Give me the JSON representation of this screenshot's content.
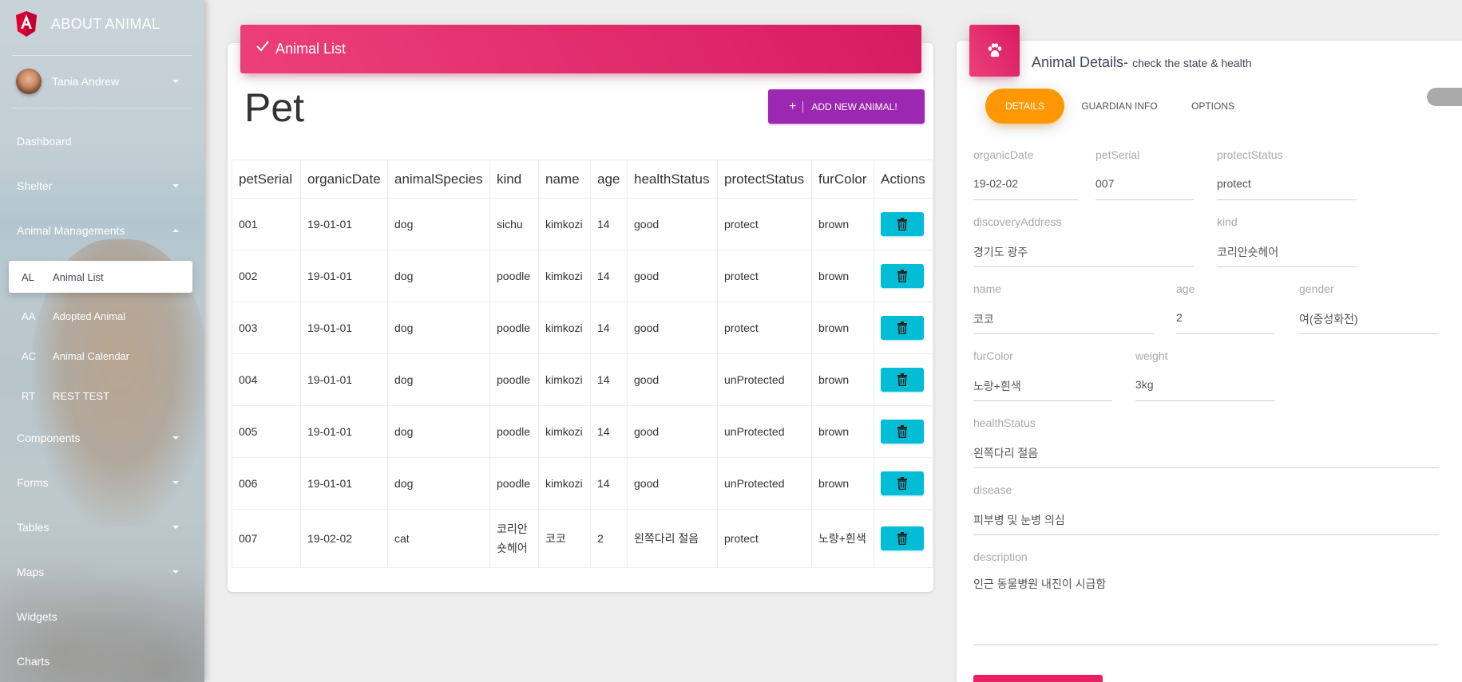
{
  "sidebar": {
    "brand": "ABOUT ANIMAL",
    "user": "Tania Andrew",
    "nav": [
      {
        "label": "Dashboard"
      },
      {
        "label": "Shelter"
      },
      {
        "label": "Animal Managements"
      },
      {
        "label": "Components"
      },
      {
        "label": "Forms"
      },
      {
        "label": "Tables"
      },
      {
        "label": "Maps"
      },
      {
        "label": "Widgets"
      },
      {
        "label": "Charts"
      }
    ],
    "subnav": [
      {
        "abbr": "AL",
        "label": "Animal List"
      },
      {
        "abbr": "AA",
        "label": "Adopted Animal"
      },
      {
        "abbr": "AC",
        "label": "Animal Calendar"
      },
      {
        "abbr": "RT",
        "label": "REST TEST"
      }
    ]
  },
  "list": {
    "header": "Animal List",
    "title": "Pet",
    "add_button": "ADD NEW ANIMAL!",
    "columns": [
      "petSerial",
      "organicDate",
      "animalSpecies",
      "kind",
      "name",
      "age",
      "healthStatus",
      "protectStatus",
      "furColor",
      "Actions"
    ],
    "rows": [
      [
        "001",
        "19-01-01",
        "dog",
        "sichu",
        "kimkozi",
        "14",
        "good",
        "protect",
        "brown"
      ],
      [
        "002",
        "19-01-01",
        "dog",
        "poodle",
        "kimkozi",
        "14",
        "good",
        "protect",
        "brown"
      ],
      [
        "003",
        "19-01-01",
        "dog",
        "poodle",
        "kimkozi",
        "14",
        "good",
        "protect",
        "brown"
      ],
      [
        "004",
        "19-01-01",
        "dog",
        "poodle",
        "kimkozi",
        "14",
        "good",
        "unProtected",
        "brown"
      ],
      [
        "005",
        "19-01-01",
        "dog",
        "poodle",
        "kimkozi",
        "14",
        "good",
        "unProtected",
        "brown"
      ],
      [
        "006",
        "19-01-01",
        "dog",
        "poodle",
        "kimkozi",
        "14",
        "good",
        "unProtected",
        "brown"
      ],
      [
        "007",
        "19-02-02",
        "cat",
        "코리안숏헤어",
        "코코",
        "2",
        "왼쪽다리 절음",
        "protect",
        "노랑+흰색"
      ]
    ]
  },
  "details": {
    "title": "Animal Details-",
    "subtitle": "check the state & health",
    "tabs": [
      "DETAILS",
      "GUARDIAN INFO",
      "OPTIONS"
    ],
    "fields": {
      "organicDate": {
        "label": "organicDate",
        "value": "19-02-02"
      },
      "petSerial": {
        "label": "petSerial",
        "value": "007"
      },
      "protectStatus": {
        "label": "protectStatus",
        "value": "protect"
      },
      "discoveryAddress": {
        "label": "discoveryAddress",
        "value": "경기도 광주"
      },
      "kind": {
        "label": "kind",
        "value": "코리안숏헤어"
      },
      "name": {
        "label": "name",
        "value": "코코"
      },
      "age": {
        "label": "age",
        "value": "2"
      },
      "gender": {
        "label": "gender",
        "value": "여(중성화전)"
      },
      "furColor": {
        "label": "furColor",
        "value": "노랑+흰색"
      },
      "weight": {
        "label": "weight",
        "value": "3kg"
      },
      "healthStatus": {
        "label": "healthStatus",
        "value": "왼쪽다리 절음"
      },
      "disease": {
        "label": "disease",
        "value": "피부병 및 눈병 의심"
      },
      "description": {
        "label": "description",
        "value": "인근 동물병원 내진이 시급함"
      }
    }
  },
  "colors": {
    "primary_pink": "#e91e63",
    "purple": "#9c27b0",
    "cyan": "#00bcd4",
    "orange": "#ff9800"
  }
}
